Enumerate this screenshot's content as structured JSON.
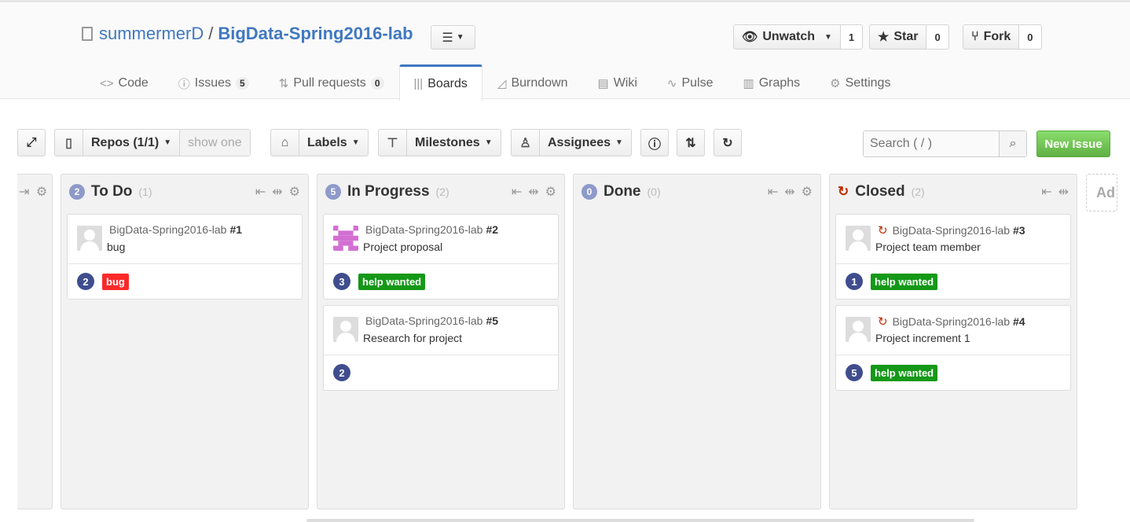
{
  "repo": {
    "owner": "summermerD",
    "separator": "/",
    "name": "BigData-Spring2016-lab"
  },
  "actions": [
    {
      "label": "Unwatch",
      "count": "1",
      "icon": "eye-icon"
    },
    {
      "label": "Star",
      "count": "0",
      "icon": "star-icon"
    },
    {
      "label": "Fork",
      "count": "0",
      "icon": "fork-icon"
    }
  ],
  "nav": {
    "code": "Code",
    "issues": "Issues",
    "issues_count": "5",
    "pulls": "Pull requests",
    "pulls_count": "0",
    "boards": "Boards",
    "burndown": "Burndown",
    "wiki": "Wiki",
    "pulse": "Pulse",
    "graphs": "Graphs",
    "settings": "Settings"
  },
  "toolbar": {
    "repos": "Repos (1/1)",
    "show_one": "show one",
    "labels": "Labels",
    "milestones": "Milestones",
    "assignees": "Assignees",
    "search_placeholder": "Search ( / )",
    "new_issue": "New Issue"
  },
  "columns": [
    {
      "badge": "2",
      "title": "To Do",
      "total": "(1)",
      "cards": [
        {
          "repo": "BigData-Spring2016-lab",
          "number": "#1",
          "title": "bug",
          "count": "2",
          "label": "bug",
          "label_color": "#fc2929",
          "avatar": "default-avatar",
          "closed": false
        }
      ]
    },
    {
      "badge": "5",
      "title": "In Progress",
      "total": "(2)",
      "cards": [
        {
          "repo": "BigData-Spring2016-lab",
          "number": "#2",
          "title": "Project proposal",
          "count": "3",
          "label": "help wanted",
          "label_color": "#159818",
          "avatar": "identicon-pink",
          "closed": false
        },
        {
          "repo": "BigData-Spring2016-lab",
          "number": "#5",
          "title": "Research for project",
          "count": "2",
          "label": "",
          "label_color": "",
          "avatar": "default-avatar",
          "closed": false
        }
      ]
    },
    {
      "badge": "0",
      "title": "Done",
      "total": "(0)",
      "cards": []
    },
    {
      "badge": "",
      "title": "Closed",
      "total": "(2)",
      "cards": [
        {
          "repo": "BigData-Spring2016-lab",
          "number": "#3",
          "title": "Project team member",
          "count": "1",
          "label": "help wanted",
          "label_color": "#159818",
          "avatar": "default-avatar",
          "closed": true
        },
        {
          "repo": "BigData-Spring2016-lab",
          "number": "#4",
          "title": "Project increment 1",
          "count": "5",
          "label": "help wanted",
          "label_color": "#159818",
          "avatar": "default-avatar",
          "closed": true
        }
      ]
    }
  ],
  "add_column": "Ad"
}
